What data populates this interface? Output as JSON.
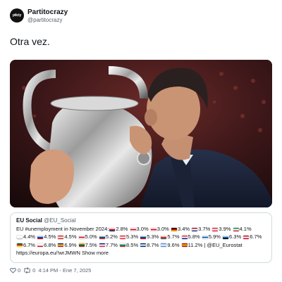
{
  "author": {
    "avatar_text": "ptlcty",
    "name": "Partitocrazy",
    "handle": "@partitocrazy"
  },
  "tweet": {
    "text": "Otra vez."
  },
  "photo": {
    "subject": "man kissing silver trophy"
  },
  "quote": {
    "name": "EU Social",
    "handle": "@EU_Social",
    "intro": "EU #unemployment in November 2024:",
    "rates": [
      {
        "value": "2.8%",
        "colors": [
          "#ffffff",
          "#d7141a",
          "#11457e"
        ]
      },
      {
        "value": "3.0%",
        "colors": [
          "#ffffff",
          "#dc143c",
          "#ffffff"
        ]
      },
      {
        "value": "3.0%",
        "colors": [
          "#ffffff",
          "#dc143c",
          "#ffffff"
        ]
      },
      {
        "value": "3.4%",
        "colors": [
          "#000000",
          "#dd0000",
          "#ffce00"
        ]
      },
      {
        "value": "3.7%",
        "colors": [
          "#ae1c28",
          "#ffffff",
          "#21468b"
        ]
      },
      {
        "value": "3.9%",
        "colors": [
          "#ed2939",
          "#ffffff",
          "#ed2939"
        ]
      },
      {
        "value": "4.1%",
        "colors": [
          "#009246",
          "#ffffff",
          "#ce2b37"
        ]
      },
      {
        "value": "4.4%",
        "colors": [
          "#ffffff",
          "#ffffff",
          "#cccccc"
        ]
      },
      {
        "value": "4.5%",
        "colors": [
          "#ffffff",
          "#0052b4",
          "#d80027"
        ]
      },
      {
        "value": "4.5%",
        "colors": [
          "#d52b1e",
          "#ffffff",
          "#d52b1e"
        ]
      },
      {
        "value": "5.0%",
        "colors": [
          "#ffffff",
          "#d22630",
          "#ffffff"
        ]
      },
      {
        "value": "5.2%",
        "colors": [
          "#ffffff",
          "#0c4076",
          "#c6363c"
        ]
      },
      {
        "value": "5.3%",
        "colors": [
          "#ed2939",
          "#ffffff",
          "#ed2939"
        ]
      },
      {
        "value": "5.3%",
        "colors": [
          "#ffffff",
          "#003da5",
          "#ce1126"
        ]
      },
      {
        "value": "5.7%",
        "colors": [
          "#ffffff",
          "#cd2a3e",
          "#436f4d"
        ]
      },
      {
        "value": "5.8%",
        "colors": [
          "#ed2939",
          "#ffffff",
          "#002395"
        ]
      },
      {
        "value": "5.9%",
        "colors": [
          "#ffffff",
          "#0d5eaf",
          "#ffffff"
        ]
      },
      {
        "value": "6.3%",
        "colors": [
          "#ffffff",
          "#0072ce",
          "#000000"
        ]
      },
      {
        "value": "6.7%",
        "colors": [
          "#c60c30",
          "#ffffff",
          "#c60c30"
        ]
      },
      {
        "value": "6.7%",
        "colors": [
          "#046a38",
          "#da291c",
          "#ffe900"
        ]
      },
      {
        "value": "6.8%",
        "colors": [
          "#ffffff",
          "#ffffff",
          "#d7141a"
        ]
      },
      {
        "value": "6.9%",
        "colors": [
          "#002b7f",
          "#fcd116",
          "#ce1126"
        ]
      },
      {
        "value": "7.5%",
        "colors": [
          "#fdb913",
          "#006a44",
          "#c1272d"
        ]
      },
      {
        "value": "7.7%",
        "colors": [
          "#002395",
          "#ffffff",
          "#ed2939"
        ]
      },
      {
        "value": "8.5%",
        "colors": [
          "#ffffff",
          "#00966e",
          "#d62612"
        ]
      },
      {
        "value": "8.7%",
        "colors": [
          "#003580",
          "#ffffff",
          "#003580"
        ]
      },
      {
        "value": "9.6%",
        "colors": [
          "#5b92e5",
          "#ffffff",
          "#5b92e5"
        ]
      },
      {
        "value": "11.2%",
        "colors": [
          "#aa151b",
          "#f1bf00",
          "#aa151b"
        ]
      }
    ],
    "tail": "| @EU_Eurostat",
    "link": "https://europa.eu/!wrJMWN",
    "show_more": "Show more"
  },
  "footer": {
    "likes": "0",
    "retweets": "0",
    "time": "4:14 PM - Ene 7, 2025"
  }
}
